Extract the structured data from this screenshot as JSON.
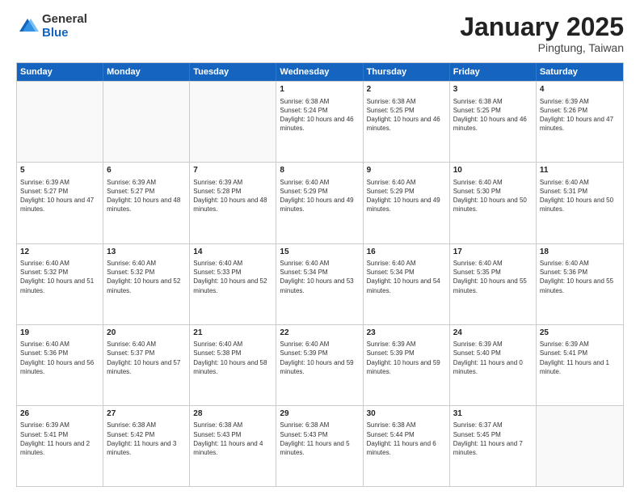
{
  "logo": {
    "general": "General",
    "blue": "Blue"
  },
  "title": {
    "month": "January 2025",
    "location": "Pingtung, Taiwan"
  },
  "days_of_week": [
    "Sunday",
    "Monday",
    "Tuesday",
    "Wednesday",
    "Thursday",
    "Friday",
    "Saturday"
  ],
  "weeks": [
    [
      {
        "day": "",
        "empty": true
      },
      {
        "day": "",
        "empty": true
      },
      {
        "day": "",
        "empty": true
      },
      {
        "day": "1",
        "sunrise": "6:38 AM",
        "sunset": "5:24 PM",
        "daylight": "10 hours and 46 minutes."
      },
      {
        "day": "2",
        "sunrise": "6:38 AM",
        "sunset": "5:25 PM",
        "daylight": "10 hours and 46 minutes."
      },
      {
        "day": "3",
        "sunrise": "6:38 AM",
        "sunset": "5:25 PM",
        "daylight": "10 hours and 46 minutes."
      },
      {
        "day": "4",
        "sunrise": "6:39 AM",
        "sunset": "5:26 PM",
        "daylight": "10 hours and 47 minutes."
      }
    ],
    [
      {
        "day": "5",
        "sunrise": "6:39 AM",
        "sunset": "5:27 PM",
        "daylight": "10 hours and 47 minutes."
      },
      {
        "day": "6",
        "sunrise": "6:39 AM",
        "sunset": "5:27 PM",
        "daylight": "10 hours and 48 minutes."
      },
      {
        "day": "7",
        "sunrise": "6:39 AM",
        "sunset": "5:28 PM",
        "daylight": "10 hours and 48 minutes."
      },
      {
        "day": "8",
        "sunrise": "6:40 AM",
        "sunset": "5:29 PM",
        "daylight": "10 hours and 49 minutes."
      },
      {
        "day": "9",
        "sunrise": "6:40 AM",
        "sunset": "5:29 PM",
        "daylight": "10 hours and 49 minutes."
      },
      {
        "day": "10",
        "sunrise": "6:40 AM",
        "sunset": "5:30 PM",
        "daylight": "10 hours and 50 minutes."
      },
      {
        "day": "11",
        "sunrise": "6:40 AM",
        "sunset": "5:31 PM",
        "daylight": "10 hours and 50 minutes."
      }
    ],
    [
      {
        "day": "12",
        "sunrise": "6:40 AM",
        "sunset": "5:32 PM",
        "daylight": "10 hours and 51 minutes."
      },
      {
        "day": "13",
        "sunrise": "6:40 AM",
        "sunset": "5:32 PM",
        "daylight": "10 hours and 52 minutes."
      },
      {
        "day": "14",
        "sunrise": "6:40 AM",
        "sunset": "5:33 PM",
        "daylight": "10 hours and 52 minutes."
      },
      {
        "day": "15",
        "sunrise": "6:40 AM",
        "sunset": "5:34 PM",
        "daylight": "10 hours and 53 minutes."
      },
      {
        "day": "16",
        "sunrise": "6:40 AM",
        "sunset": "5:34 PM",
        "daylight": "10 hours and 54 minutes."
      },
      {
        "day": "17",
        "sunrise": "6:40 AM",
        "sunset": "5:35 PM",
        "daylight": "10 hours and 55 minutes."
      },
      {
        "day": "18",
        "sunrise": "6:40 AM",
        "sunset": "5:36 PM",
        "daylight": "10 hours and 55 minutes."
      }
    ],
    [
      {
        "day": "19",
        "sunrise": "6:40 AM",
        "sunset": "5:36 PM",
        "daylight": "10 hours and 56 minutes."
      },
      {
        "day": "20",
        "sunrise": "6:40 AM",
        "sunset": "5:37 PM",
        "daylight": "10 hours and 57 minutes."
      },
      {
        "day": "21",
        "sunrise": "6:40 AM",
        "sunset": "5:38 PM",
        "daylight": "10 hours and 58 minutes."
      },
      {
        "day": "22",
        "sunrise": "6:40 AM",
        "sunset": "5:39 PM",
        "daylight": "10 hours and 59 minutes."
      },
      {
        "day": "23",
        "sunrise": "6:39 AM",
        "sunset": "5:39 PM",
        "daylight": "10 hours and 59 minutes."
      },
      {
        "day": "24",
        "sunrise": "6:39 AM",
        "sunset": "5:40 PM",
        "daylight": "11 hours and 0 minutes."
      },
      {
        "day": "25",
        "sunrise": "6:39 AM",
        "sunset": "5:41 PM",
        "daylight": "11 hours and 1 minute."
      }
    ],
    [
      {
        "day": "26",
        "sunrise": "6:39 AM",
        "sunset": "5:41 PM",
        "daylight": "11 hours and 2 minutes."
      },
      {
        "day": "27",
        "sunrise": "6:38 AM",
        "sunset": "5:42 PM",
        "daylight": "11 hours and 3 minutes."
      },
      {
        "day": "28",
        "sunrise": "6:38 AM",
        "sunset": "5:43 PM",
        "daylight": "11 hours and 4 minutes."
      },
      {
        "day": "29",
        "sunrise": "6:38 AM",
        "sunset": "5:43 PM",
        "daylight": "11 hours and 5 minutes."
      },
      {
        "day": "30",
        "sunrise": "6:38 AM",
        "sunset": "5:44 PM",
        "daylight": "11 hours and 6 minutes."
      },
      {
        "day": "31",
        "sunrise": "6:37 AM",
        "sunset": "5:45 PM",
        "daylight": "11 hours and 7 minutes."
      },
      {
        "day": "",
        "empty": true
      }
    ]
  ]
}
